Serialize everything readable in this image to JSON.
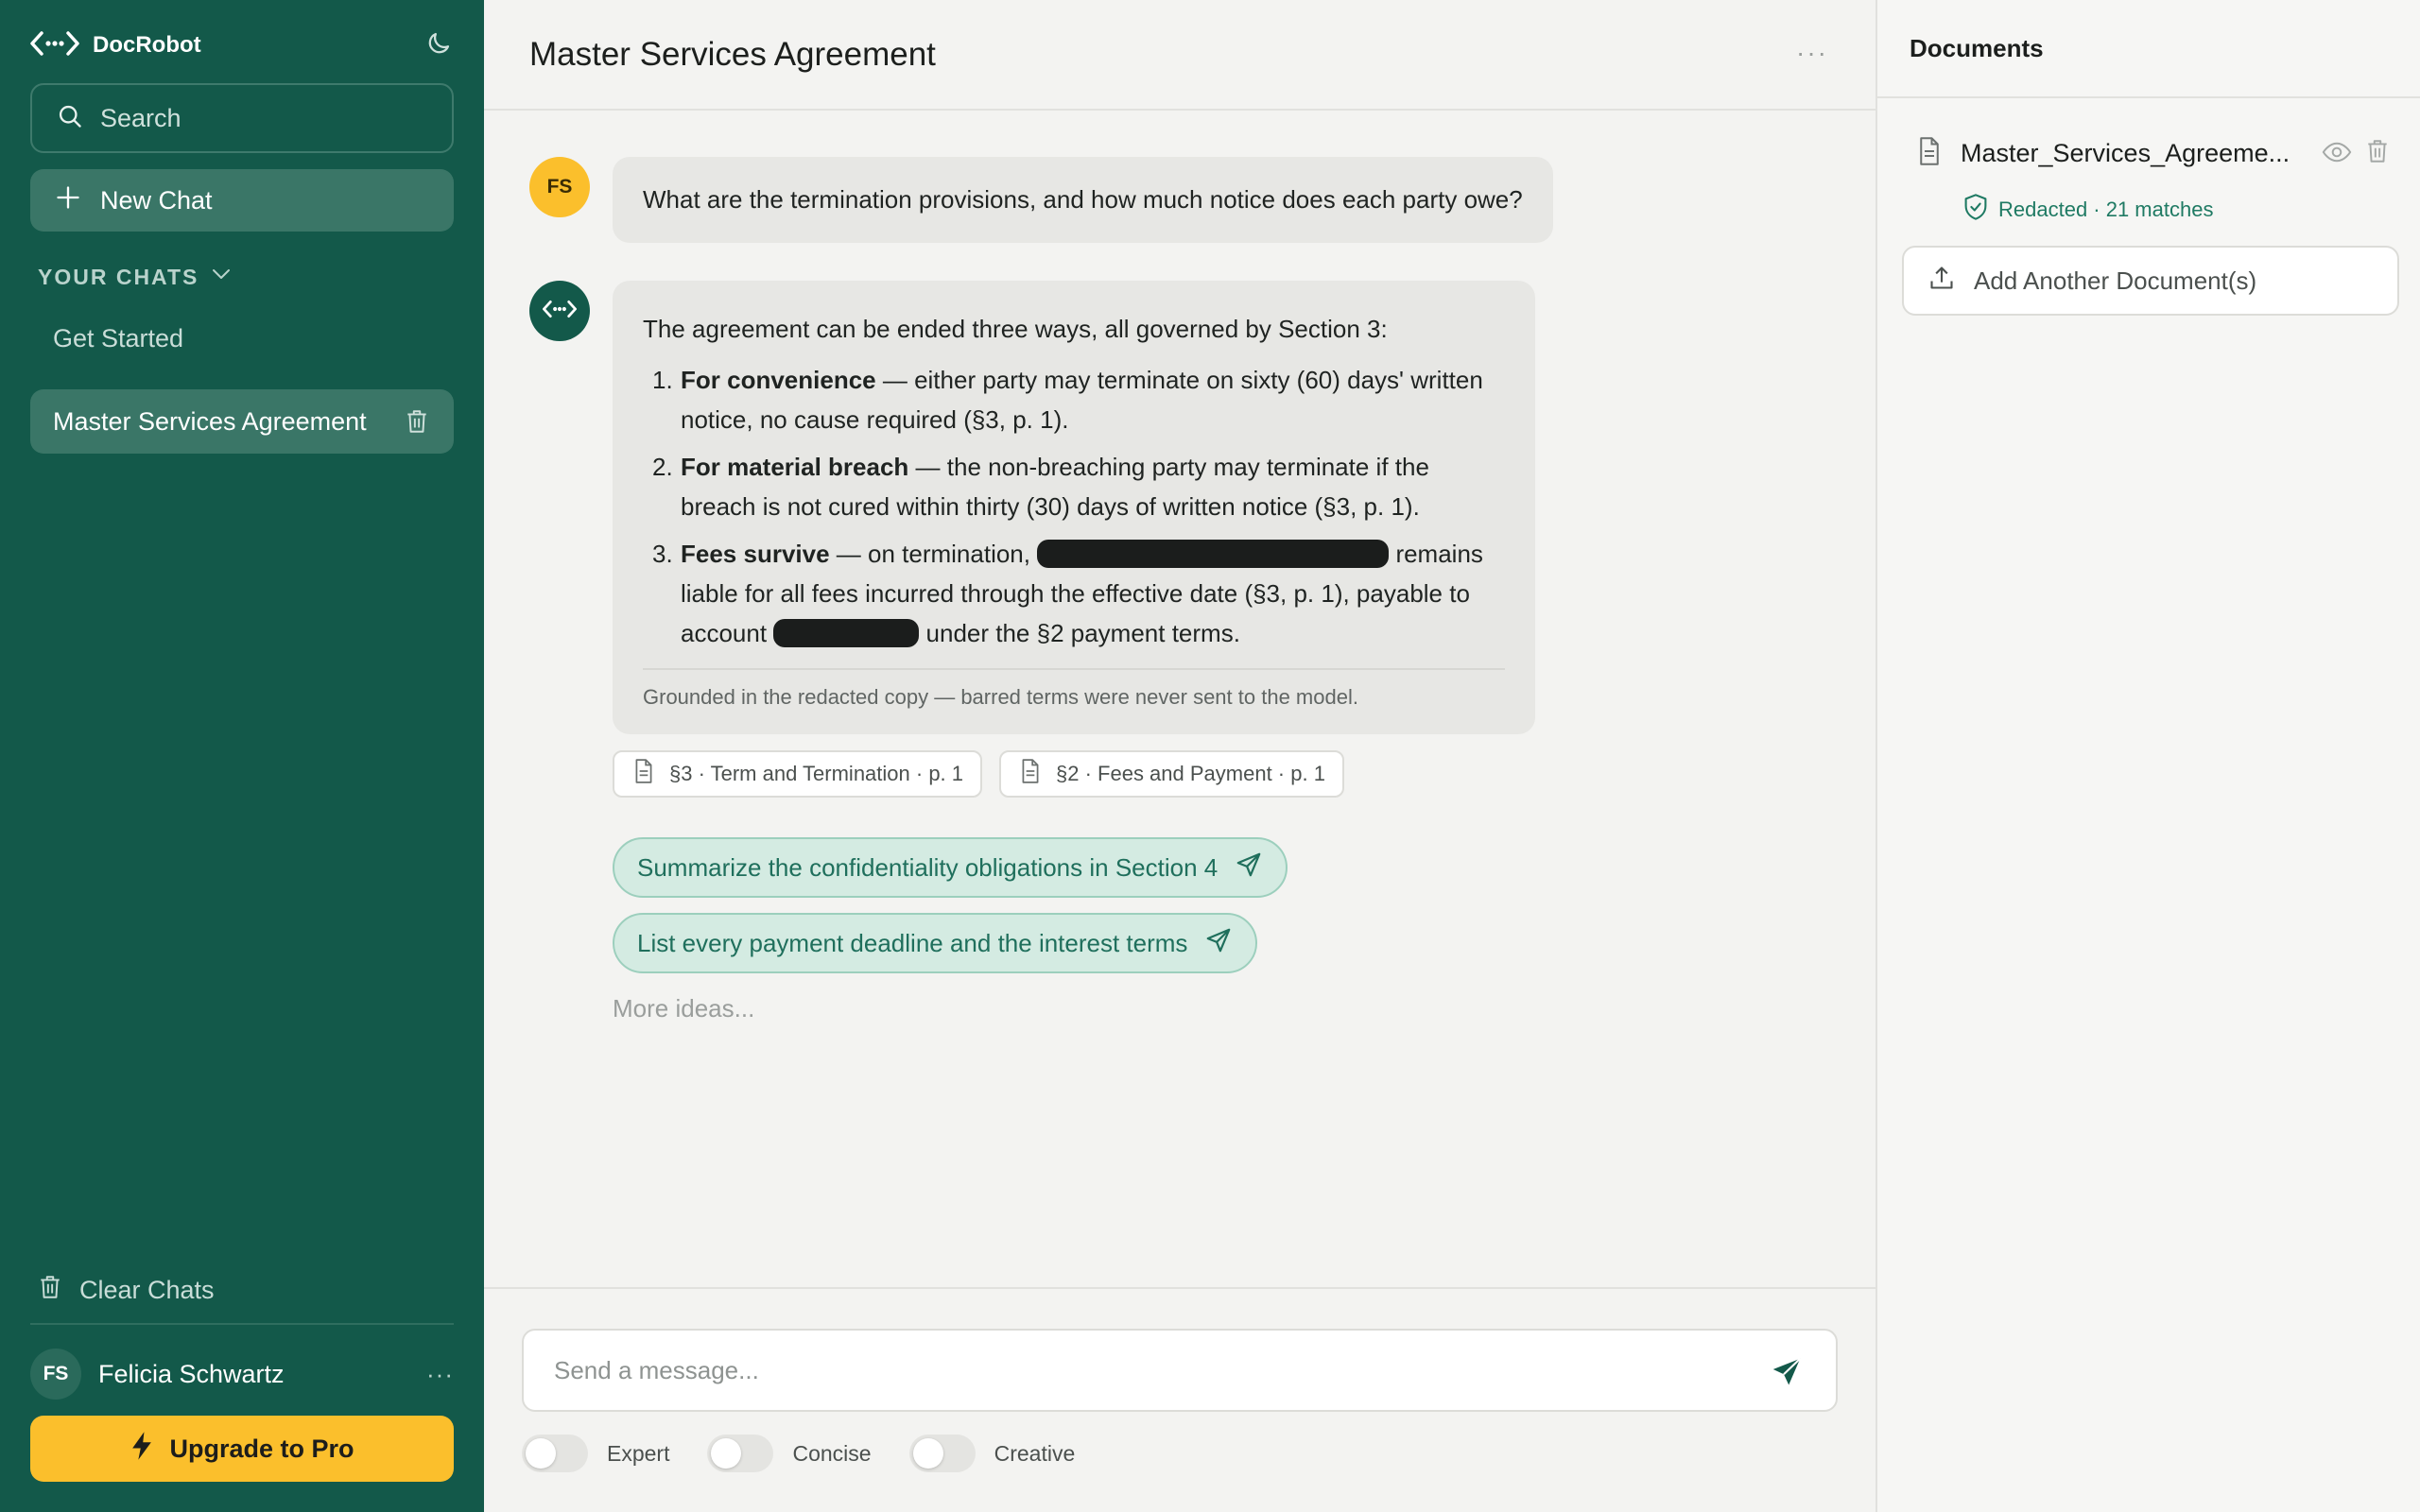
{
  "app": {
    "name": "DocRobot"
  },
  "sidebar": {
    "search_placeholder": "Search",
    "new_chat_label": "New Chat",
    "section_label": "YOUR CHATS",
    "chats": [
      {
        "label": "Get Started"
      },
      {
        "label": "Master Services Agreement",
        "active": true
      }
    ],
    "clear_label": "Clear Chats",
    "user": {
      "initials": "FS",
      "name": "Felicia Schwartz"
    },
    "upgrade_label": "Upgrade to Pro"
  },
  "main": {
    "title": "Master Services Agreement",
    "user_message": {
      "initials": "FS",
      "text": "What are the termination provisions, and how much notice does each party owe?"
    },
    "bot_message": {
      "intro": "The agreement can be ended three ways, all governed by Section 3:",
      "items": [
        {
          "num": "1.",
          "bold": "For convenience",
          "text": " — either party may terminate on sixty (60) days' written notice, no cause required (§3, p. 1)."
        },
        {
          "num": "2.",
          "bold": "For material breach",
          "text": " — the non-breaching party may terminate if the breach is not cured within thirty (30) days of written notice (§3, p. 1)."
        },
        {
          "num": "3.",
          "bold": "Fees survive",
          "text_a": " — on termination, ",
          "text_b": " remains liable for all fees incurred through the effective date (§3, p. 1), payable to account ",
          "text_c": " under the §2 payment terms."
        }
      ],
      "footer": "Grounded in the redacted copy — barred terms were never sent to the model."
    },
    "citations": [
      {
        "label": "§3 · Term and Termination · p. 1"
      },
      {
        "label": "§2 · Fees and Payment · p. 1"
      }
    ],
    "suggestions": [
      {
        "label": "Summarize the confidentiality obligations in Section 4"
      },
      {
        "label": "List every payment deadline and the interest terms"
      }
    ],
    "more_ideas": "More ideas...",
    "composer_placeholder": "Send a message...",
    "toggles": [
      {
        "label": "Expert",
        "on": false
      },
      {
        "label": "Concise",
        "on": false
      },
      {
        "label": "Creative",
        "on": false
      }
    ]
  },
  "documents": {
    "title": "Documents",
    "file_name": "Master_Services_Agreeme...",
    "status": "Redacted · 21 matches",
    "add_label": "Add Another Document(s)"
  },
  "colors": {
    "sidebar_bg": "#13594a",
    "accent_yellow": "#fbbf2c",
    "suggestion_bg": "#d4ebe2",
    "accent_green": "#1f7a63"
  }
}
